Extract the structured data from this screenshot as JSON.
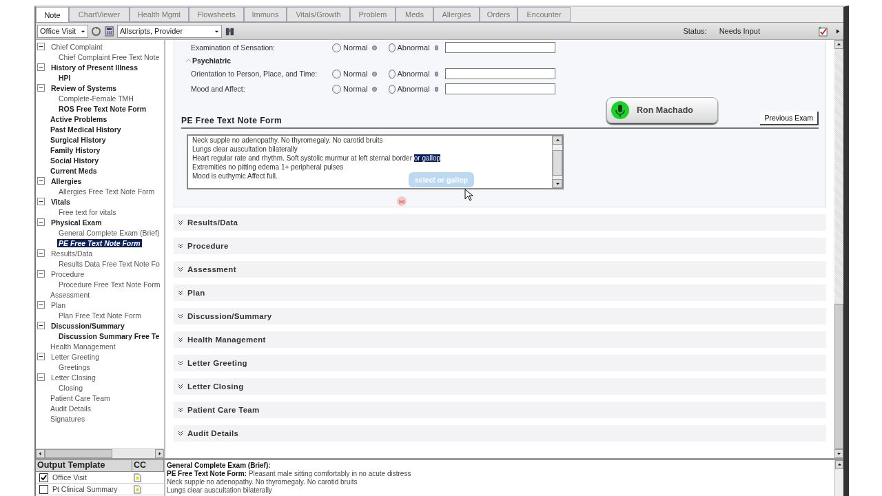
{
  "tabs": [
    {
      "label": "Note",
      "selected": true
    },
    {
      "label": "ChartViewer",
      "selected": false
    },
    {
      "label": "Health Mgmt",
      "selected": false
    },
    {
      "label": "Flowsheets",
      "selected": false
    },
    {
      "label": "Immuns",
      "selected": false
    },
    {
      "label": "Vitals/Growth",
      "selected": false
    },
    {
      "label": "Problem",
      "selected": false
    },
    {
      "label": "Meds",
      "selected": false
    },
    {
      "label": "Allergies",
      "selected": false
    },
    {
      "label": "Orders",
      "selected": false
    },
    {
      "label": "Encounter",
      "selected": false
    }
  ],
  "toolbar": {
    "note_type": "Office Visit",
    "provider": "Allscripts, Provider",
    "status_label": "Status:",
    "status_value": "Needs Input"
  },
  "tree": [
    {
      "label": "Chief Complaint",
      "bold": false,
      "selected": false,
      "expanded": true,
      "children": [
        {
          "label": "Chief Complaint Free Text Note",
          "bold": false,
          "selected": false
        }
      ]
    },
    {
      "label": "History of Present Illness",
      "bold": true,
      "selected": false,
      "expanded": true,
      "children": [
        {
          "label": "HPI",
          "bold": true,
          "selected": false
        }
      ]
    },
    {
      "label": "Review of Systems",
      "bold": true,
      "selected": false,
      "expanded": true,
      "children": [
        {
          "label": "Complete-Female TMH",
          "bold": false,
          "selected": false
        },
        {
          "label": "ROS Free Text Note Form",
          "bold": true,
          "selected": false
        }
      ]
    },
    {
      "label": "Active Problems",
      "bold": true,
      "selected": false
    },
    {
      "label": "Past Medical History",
      "bold": true,
      "selected": false
    },
    {
      "label": "Surgical History",
      "bold": true,
      "selected": false
    },
    {
      "label": "Family History",
      "bold": true,
      "selected": false
    },
    {
      "label": "Social History",
      "bold": true,
      "selected": false
    },
    {
      "label": "Current Meds",
      "bold": true,
      "selected": false
    },
    {
      "label": "Allergies",
      "bold": true,
      "selected": false,
      "expanded": true,
      "children": [
        {
          "label": "Allergies Free Text Note Form",
          "bold": false,
          "selected": false
        }
      ]
    },
    {
      "label": "Vitals",
      "bold": true,
      "selected": false,
      "expanded": true,
      "children": [
        {
          "label": "Free text for vitals",
          "bold": false,
          "selected": false
        }
      ]
    },
    {
      "label": "Physical Exam",
      "bold": true,
      "selected": false,
      "expanded": true,
      "children": [
        {
          "label": "General Complete Exam (Brief)",
          "bold": false,
          "selected": false
        },
        {
          "label": "PE Free Text Note Form",
          "bold": true,
          "selected": true
        }
      ]
    },
    {
      "label": "Results/Data",
      "bold": false,
      "selected": false,
      "expanded": true,
      "children": [
        {
          "label": "Results Data Free Text Note Fo",
          "bold": false,
          "selected": false
        }
      ]
    },
    {
      "label": "Procedure",
      "bold": false,
      "selected": false,
      "expanded": true,
      "children": [
        {
          "label": "Procedure Free Text Note Form",
          "bold": false,
          "selected": false
        }
      ]
    },
    {
      "label": "Assessment",
      "bold": false,
      "selected": false
    },
    {
      "label": "Plan",
      "bold": false,
      "selected": false,
      "expanded": true,
      "children": [
        {
          "label": "Plan Free Text Note Form",
          "bold": false,
          "selected": false
        }
      ]
    },
    {
      "label": "Discussion/Summary",
      "bold": true,
      "selected": false,
      "expanded": true,
      "children": [
        {
          "label": "Discussion Summary Free Te",
          "bold": true,
          "selected": false
        }
      ]
    },
    {
      "label": "Health Management",
      "bold": false,
      "selected": false
    },
    {
      "label": "Letter Greeting",
      "bold": false,
      "selected": false,
      "expanded": true,
      "children": [
        {
          "label": "Greetings",
          "bold": false,
          "selected": false
        }
      ]
    },
    {
      "label": "Letter Closing",
      "bold": false,
      "selected": false,
      "expanded": true,
      "children": [
        {
          "label": "Closing",
          "bold": false,
          "selected": false
        }
      ]
    },
    {
      "label": "Patient Care Team",
      "bold": false,
      "selected": false
    },
    {
      "label": "Audit Details",
      "bold": false,
      "selected": false
    },
    {
      "label": "Signatures",
      "bold": false,
      "selected": false
    }
  ],
  "output_template": {
    "columns": [
      "Output Template",
      "CC"
    ],
    "rows": [
      {
        "label": "Office Visit",
        "checked": true
      },
      {
        "label": "Pt Clinical Summary",
        "checked": false
      }
    ]
  },
  "exam": [
    {
      "kind": "row",
      "label": "Examination of Sensation:",
      "options": [
        {
          "label": "Normal",
          "selected": false
        },
        {
          "label": "Abnormal",
          "selected": false
        }
      ]
    },
    {
      "kind": "heading",
      "label": "Psychiatric",
      "expanded": true
    },
    {
      "kind": "row",
      "label": "Orientation to Person, Place, and Time:",
      "options": [
        {
          "label": "Normal",
          "selected": false
        },
        {
          "label": "Abnormal",
          "selected": false
        }
      ]
    },
    {
      "kind": "row",
      "label": "Mood and Affect:",
      "options": [
        {
          "label": "Normal",
          "selected": false
        },
        {
          "label": "Abnormal",
          "selected": false
        }
      ]
    }
  ],
  "dictation": {
    "label": "Ron Machado"
  },
  "previous_exam": "Previous Exam",
  "note_form": {
    "title": "PE Free Text Note Form",
    "lines": [
      {
        "text": "Neck supple no adenopathy.  No thyromegaly.  No carotid bruits"
      },
      {
        "text": "Lungs clear auscultation bilaterally"
      },
      {
        "text": "Heart regular rate and rhythm.  Soft systolic murmur at left sternal border ",
        "highlight": "or gallop"
      },
      {
        "text": "Extremities no pitting edema 1+ peripheral pulses"
      },
      {
        "text": "Mood is euthymic Affect  full."
      }
    ],
    "tooltip": "select or gallop"
  },
  "sections": [
    "Results/Data",
    "Procedure",
    "Assessment",
    "Plan",
    "Discussion/Summary",
    "Health Management",
    "Letter Greeting",
    "Letter Closing",
    "Patient Care Team",
    "Audit Details"
  ],
  "output": [
    {
      "label": "General Complete Exam (Brief):"
    },
    {
      "label": "PE Free Text Note Form:",
      "value": "Pleasant male sitting comfortably in no acute distress"
    },
    {
      "value": "Neck supple no adenopathy. No thyromegaly. No carotid bruits"
    },
    {
      "value": "Lungs clear auscultation bilaterally"
    }
  ]
}
